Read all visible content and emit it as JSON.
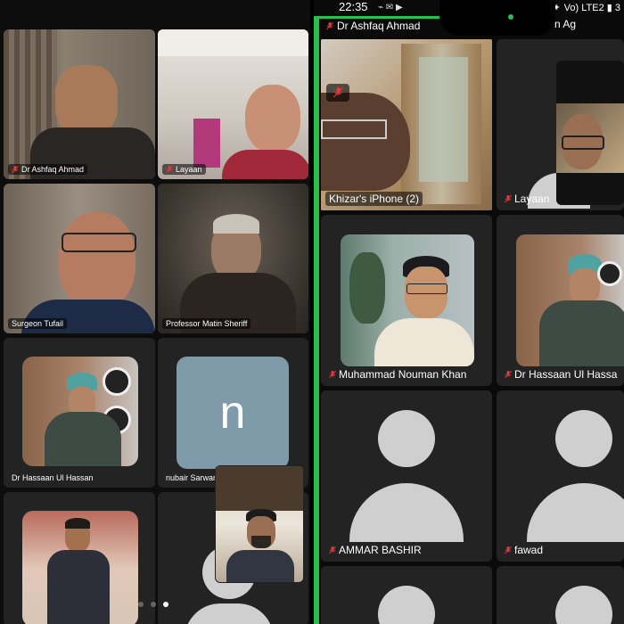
{
  "left_panel": {
    "tiles": [
      {
        "name": "Dr Ashfaq Ahmad",
        "muted": true
      },
      {
        "name": "Layaan",
        "muted": true
      },
      {
        "name": "Surgeon Tufail",
        "muted": false
      },
      {
        "name": "Professor Matin Sheriff",
        "muted": false
      },
      {
        "name": "Dr Hassaan Ul Hassan",
        "muted": false
      },
      {
        "name": "nubair Sarwar",
        "muted": false,
        "initial": "n"
      }
    ],
    "page_dots": 3,
    "active_dot": 2
  },
  "right_panel": {
    "status_bar": {
      "time": "22:35",
      "icons": "Vo) LTE2 ▮ 3"
    },
    "top_strip": [
      {
        "name": "Dr Ashfaq Ahmad",
        "muted": true
      },
      {
        "name": "n Ag",
        "muted": false
      }
    ],
    "tiles": [
      {
        "name": "Khizar's iPhone (2)",
        "muted": true
      },
      {
        "name": "Layaan",
        "muted": true
      },
      {
        "name": "Muhammad Nouman Khan",
        "muted": true
      },
      {
        "name": "Dr Hassaan Ul Hassa",
        "muted": true
      },
      {
        "name": "AMMAR BASHIR",
        "muted": true
      },
      {
        "name": "fawad",
        "muted": true
      }
    ]
  },
  "colors": {
    "active_border": "#27c14a",
    "muted_icon": "#e03a3a",
    "tile_bg": "#232323",
    "initial_bg": "#7f9aa8"
  }
}
